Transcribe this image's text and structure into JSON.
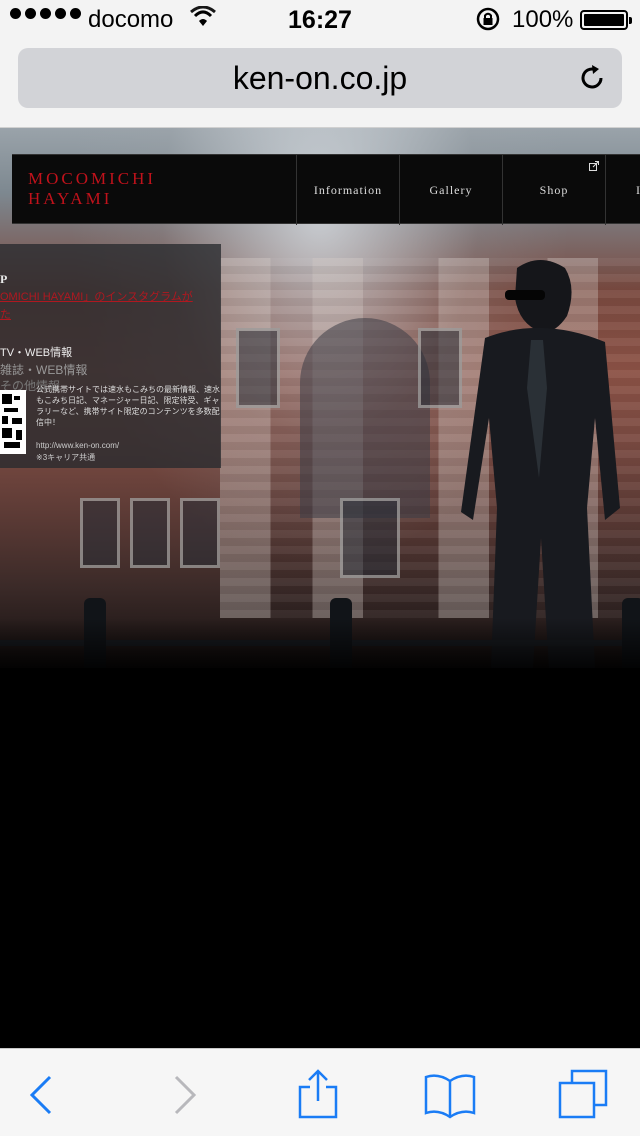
{
  "status_bar": {
    "carrier": "docomo",
    "time": "16:27",
    "battery_percent": "100%"
  },
  "browser": {
    "url": "ken-on.co.jp"
  },
  "site": {
    "logo_line1": "MOCOMICHI",
    "logo_line2": "HAYAMI",
    "nav": [
      "Information",
      "Gallery",
      "Shop",
      "I"
    ]
  },
  "panel": {
    "heading": "P",
    "instagram_link": "OMICHI HAYAMI」のインスタグラムが",
    "instagram_link_cont": "た",
    "tv_web": "TV・WEB情報",
    "magazine": "雑誌・WEB情報",
    "other": "その他情報",
    "mobile_desc": "公式携帯サイトでは速水もこみちの最新情報、速水もこみち日記、マネージャー日記、限定待受、ギャラリーなど、携帯サイト限定のコンテンツを多数配信中！",
    "mobile_url": "http://www.ken-on.com/",
    "mobile_note": "※3キャリア共通"
  },
  "colors": {
    "brand_red": "#c0121b",
    "link_blue": "#1a7cf5"
  },
  "toolbar": {
    "icons": [
      "back-icon",
      "forward-icon",
      "share-icon",
      "bookmarks-icon",
      "tabs-icon"
    ]
  }
}
